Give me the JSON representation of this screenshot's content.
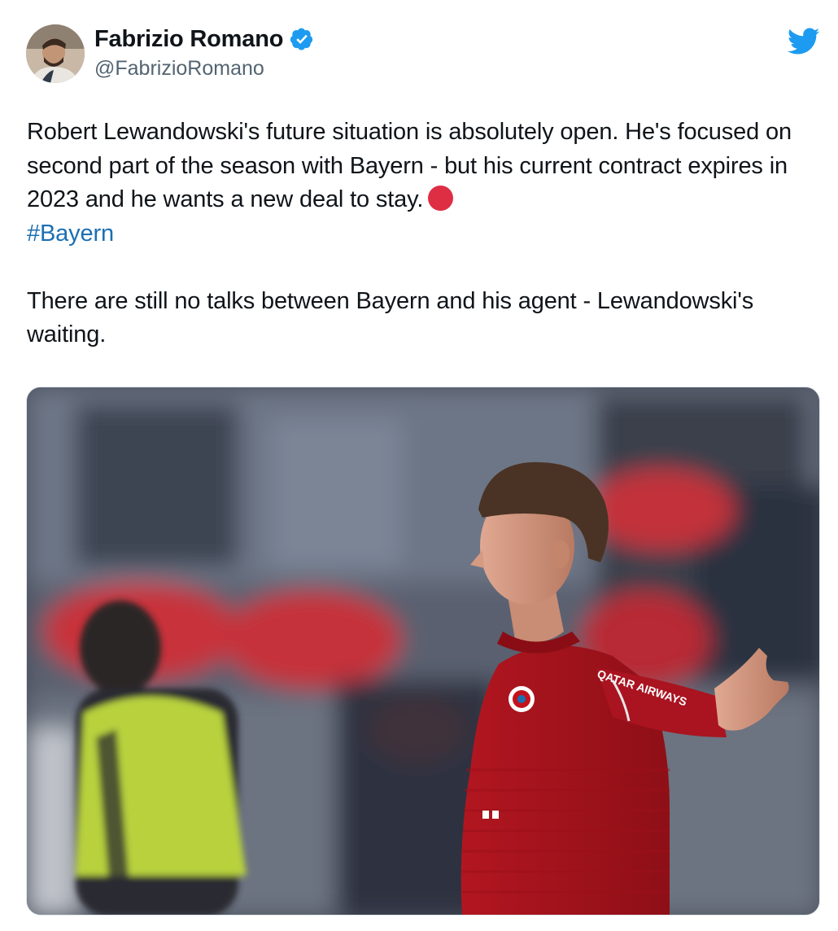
{
  "tweet": {
    "author": {
      "display_name": "Fabrizio Romano",
      "handle": "@FabrizioRomano",
      "verified": true,
      "avatar_icon": "author-avatar-photo"
    },
    "platform_icon": "twitter-bird-icon",
    "text": {
      "paragraph_1": "Robert Lewandowski's future situation is absolutely open. He's focused on second part of the season with Bayern - but his current contract expires in 2023 and he wants a new deal to stay.",
      "emoji": "red-circle-emoji",
      "hashtag": "#Bayern",
      "paragraph_2": "There are still no talks between Bayern and his agent - Lewandowski's waiting."
    },
    "media": {
      "type": "photo",
      "jersey_sponsor_text": "QATAR AIRWAYS"
    }
  },
  "colors": {
    "twitter_blue": "#1d9bf0",
    "hashtag_blue": "#1b6fb3",
    "text_primary": "#0f1419",
    "text_secondary": "#536471",
    "red_circle": "#dd2e44",
    "bayern_red": "#b4121c"
  }
}
